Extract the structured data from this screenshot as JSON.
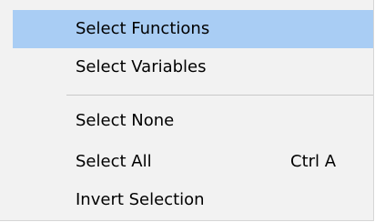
{
  "menu": {
    "items": [
      {
        "label": "Select Functions",
        "shortcut": ""
      },
      {
        "label": "Select Variables",
        "shortcut": ""
      },
      {
        "label": "Select None",
        "shortcut": ""
      },
      {
        "label": "Select All",
        "shortcut": "Ctrl A"
      },
      {
        "label": "Invert Selection",
        "shortcut": ""
      }
    ],
    "highlighted_item": "Select Functions",
    "colors": {
      "background": "#f2f2f2",
      "highlight": "#a9cdf4",
      "separator": "#c8c8c8",
      "text": "#000000"
    }
  }
}
